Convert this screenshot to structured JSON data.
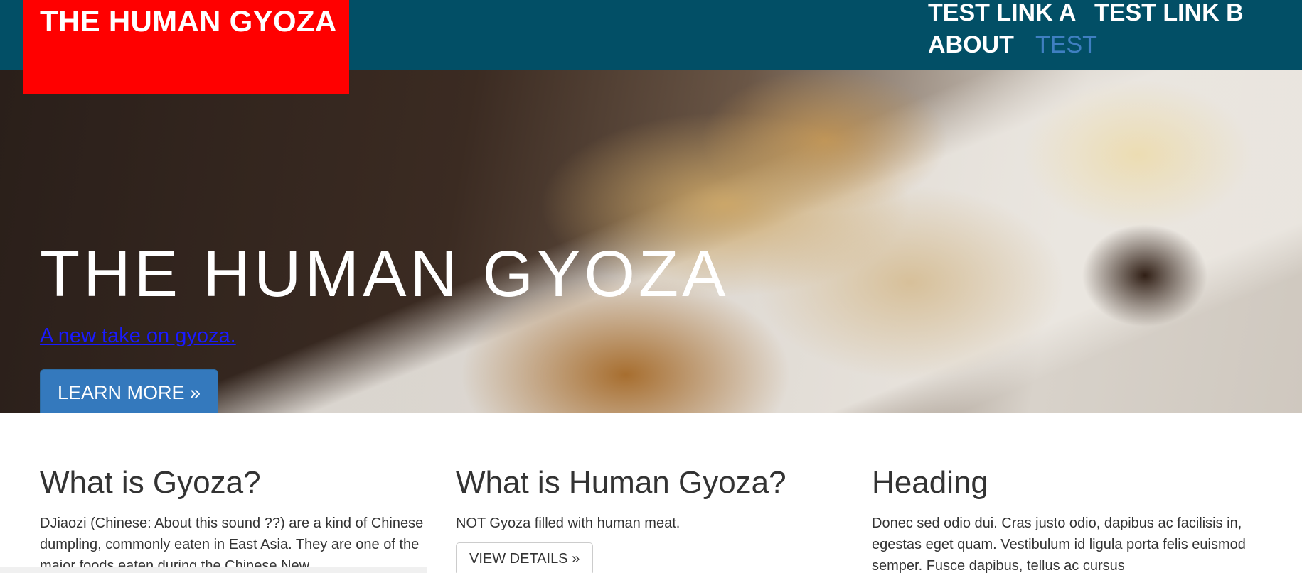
{
  "header": {
    "brand": "THE HUMAN GYOZA",
    "nav": [
      {
        "label": "TEST LINK A",
        "active": false
      },
      {
        "label": "TEST LINK B",
        "active": false
      },
      {
        "label": "ABOUT",
        "active": false
      },
      {
        "label": "TEST",
        "active": true
      }
    ]
  },
  "hero": {
    "title": "THE HUMAN GYOZA",
    "subtitle": "A new take on gyoza.",
    "button_label": "LEARN MORE »",
    "image": "gyoza-photo"
  },
  "columns": [
    {
      "heading": "What is Gyoza?",
      "body": "DJiaozi (Chinese: About this sound ??) are a kind of Chinese dumpling, commonly eaten in East Asia. They are one of the major foods eaten during the Chinese New"
    },
    {
      "heading": "What is Human Gyoza?",
      "body": "NOT Gyoza filled with human meat.",
      "button_label": "VIEW DETAILS »"
    },
    {
      "heading": "Heading",
      "body": "Donec sed odio dui. Cras justo odio, dapibus ac facilisis in, egestas eget quam. Vestibulum id ligula porta felis euismod semper. Fusce dapibus, tellus ac cursus"
    }
  ],
  "colors": {
    "header_bg": "#024f66",
    "brand_bg": "#ff0000",
    "active_link": "#3f7fc1",
    "primary_button": "#3479bd",
    "subtitle_link": "#1a1aff"
  }
}
